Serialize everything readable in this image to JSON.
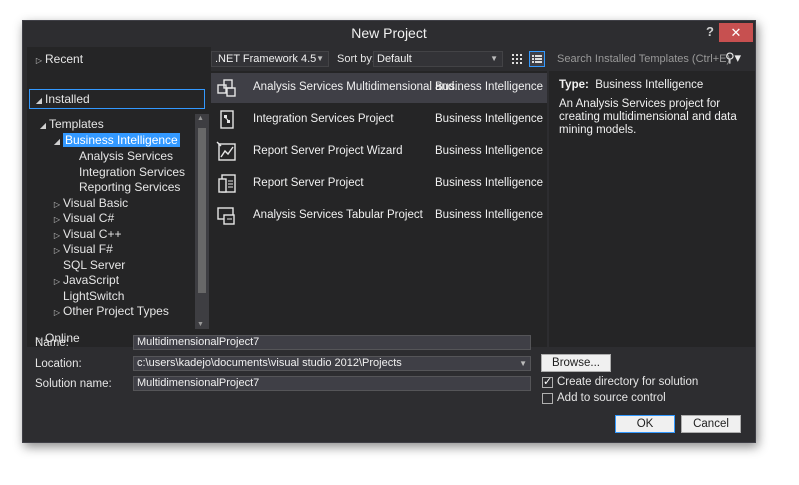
{
  "window": {
    "title": "New Project",
    "help_label": "?",
    "close_label": "✕"
  },
  "left_panel": {
    "recent": "Recent",
    "installed": "Installed",
    "templates": "Templates",
    "business_intelligence": "Business Intelligence",
    "bi_children": [
      "Analysis Services",
      "Integration Services",
      "Reporting Services"
    ],
    "languages": [
      "Visual Basic",
      "Visual C#",
      "Visual C++",
      "Visual F#",
      "SQL Server",
      "JavaScript",
      "LightSwitch",
      "Other Project Types"
    ],
    "online": "Online"
  },
  "toolbar": {
    "framework": ".NET Framework 4.5",
    "sort_label": "Sort by:",
    "sort_value": "Default",
    "search_placeholder": "Search Installed Templates (Ctrl+E)"
  },
  "templates": [
    {
      "name": "Analysis Services Multidimensional and...",
      "category": "Business Intelligence",
      "icon": "cube-icon"
    },
    {
      "name": "Integration Services Project",
      "category": "Business Intelligence",
      "icon": "package-icon"
    },
    {
      "name": "Report Server Project Wizard",
      "category": "Business Intelligence",
      "icon": "report-wizard-icon"
    },
    {
      "name": "Report Server Project",
      "category": "Business Intelligence",
      "icon": "report-icon"
    },
    {
      "name": "Analysis Services Tabular Project",
      "category": "Business Intelligence",
      "icon": "tabular-icon"
    }
  ],
  "description": {
    "type_label": "Type:",
    "type_value": "Business Intelligence",
    "text": "An Analysis Services project for creating multidimensional and data mining models."
  },
  "form": {
    "name_label": "Name:",
    "name_value": "MultidimensionalProject7",
    "location_label": "Location:",
    "location_value": "c:\\users\\kadejo\\documents\\visual studio 2012\\Projects",
    "solution_label": "Solution name:",
    "solution_value": "MultidimensionalProject7",
    "browse_label": "Browse...",
    "create_dir_label": "Create directory for solution",
    "create_dir_checked": true,
    "source_control_label": "Add to source control",
    "source_control_checked": false,
    "ok_label": "OK",
    "cancel_label": "Cancel"
  },
  "colors": {
    "accent": "#3399ff",
    "background": "#2d2d30",
    "panel": "#252526"
  }
}
